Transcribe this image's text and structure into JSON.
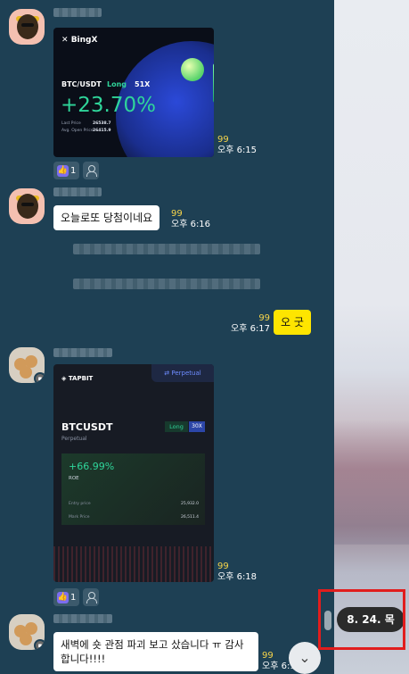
{
  "messages": {
    "m1": {
      "read_count": "99",
      "time": "오후 6:15",
      "reaction_count": "1"
    },
    "m2": {
      "text": "오늘로또 당첨이네요",
      "read_count": "99",
      "time": "오후 6:16"
    },
    "m3": {
      "text": "오 굿",
      "read_count": "99",
      "time": "오후 6:17"
    },
    "m4": {
      "read_count": "99",
      "time": "오후 6:18",
      "reaction_count": "1"
    },
    "m5": {
      "text": "새벽에 숏 관점 파괴 보고 샀습니다 ㅠ 감사합니다!!!!",
      "read_count": "99",
      "time": "오후 6:19"
    }
  },
  "bingx_card": {
    "logo": "BingX",
    "pair": "BTC/USDT",
    "side": "Long",
    "leverage": "51X",
    "pnl": "+23.70%",
    "last_price_label": "Last Price",
    "last_price": "26538.7",
    "avg_open_label": "Avg. Open Price",
    "avg_open": "26415.9"
  },
  "tapbit_card": {
    "logo": "TAPBIT",
    "tag": "Perpetual",
    "pair": "BTCUSDT",
    "sub": "Perpetual",
    "side": "Long",
    "leverage": "30X",
    "pnl": "+66.99%",
    "roe_label": "ROE",
    "entry_label": "Entry price",
    "entry": "25,932.0",
    "mark_label": "Mark Price",
    "mark": "26,511.4"
  },
  "date_indicator": "8. 24. 목",
  "scroll_down_icon": "chevron-down-icon",
  "colors": {
    "chat_bg": "#1e4054",
    "my_bubble": "#fee500",
    "read_count": "#f6d44a",
    "highlight": "#e11d1d"
  }
}
